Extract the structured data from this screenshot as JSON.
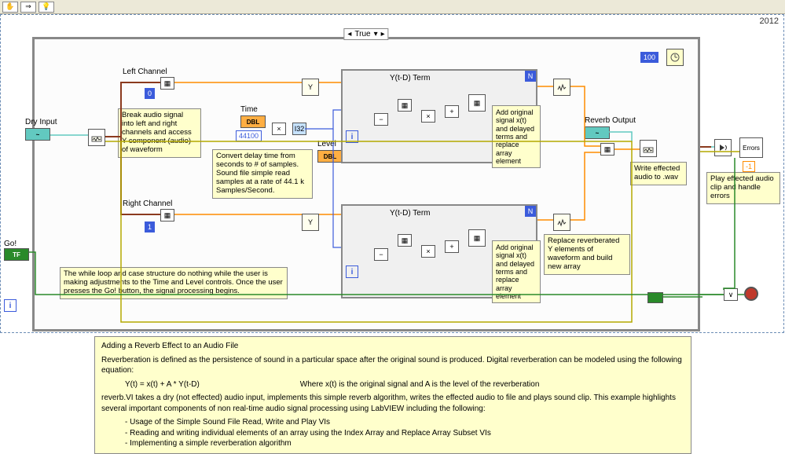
{
  "toolbar": {
    "hand": "✋",
    "runArrow": "⇒",
    "highlight": "💡"
  },
  "year": "2012",
  "caseSelector": {
    "value": "True",
    "caret": "▾",
    "left": "◂",
    "right": "▸"
  },
  "labels": {
    "leftChannel": "Left Channel",
    "rightChannel": "Right Channel",
    "dryInput": "Dry Input",
    "time": "Time",
    "level": "Level",
    "ytdTerm": "Y(t-D) Term",
    "reverbOutput": "Reverb Output",
    "go": "Go!",
    "i32": "I32"
  },
  "constants": {
    "zero": "0",
    "one": "1",
    "sampleRate": "44100",
    "hundred": "100",
    "minusOne": "-1"
  },
  "terminals": {
    "dbl": "DBL",
    "tf": "TF",
    "n": "N",
    "i": "i",
    "y": "Y"
  },
  "comments": {
    "breakAudio": "Break audio signal into left and right channels and access Y component (audio) of waveform",
    "convertDelay": "Convert delay time from seconds to # of samples. Sound file simple read samples at a rate of 44.1 k Samples/Second.",
    "addOriginalLeft": "Add original signal x(t) and delayed terms and replace array element",
    "addOriginalRight": "Add original signal x(t) and delayed terms and replace array element",
    "writeWav": "Write effected audio to .wav",
    "playClip": "Play effected audio clip and handle errors",
    "replaceReverb": "Replace reverberated Y elements of waveform and build new array",
    "whileLoop": "The while loop and case structure do nothing while the user is making adjustments to the Time and Level controls. Once the user presses the Go! button, the signal processing begins."
  },
  "doc": {
    "title": "Adding a Reverb Effect to an Audio File",
    "p1": "Reverberation is defined as the persistence of sound in a particular space after the original sound is produced. Digital reverberation can be modeled using the following equation:",
    "equation": "Y(t) = x(t)  + A * Y(t-D)",
    "equationNote": "Where x(t) is the original signal and A is the level of the reverberation",
    "p2": "reverb.VI takes a dry (not effected) audio input, implements this simple reverb algorithm, writes the effected audio to file and plays sound clip. This example highlights several important components of non real-time audio signal processing using LabVIEW including the following:",
    "bullet1": "- Usage of the Simple Sound File Read, Write and Play VIs",
    "bullet2": "- Reading and writing individual elements of an array using the Index Array and Replace Array Subset VIs",
    "bullet3": "- Implementing a simple reverberation algorithm"
  },
  "errorsLabel": "Errors"
}
